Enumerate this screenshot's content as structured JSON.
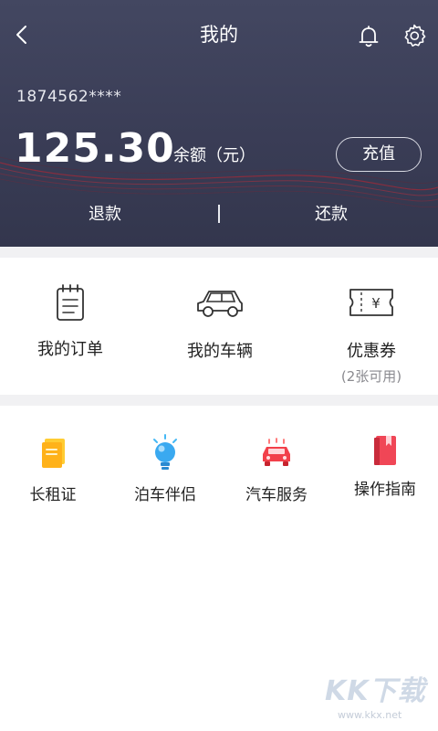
{
  "header": {
    "title": "我的",
    "phone": "1874562****",
    "balance": "125.30",
    "balance_label": "余额（元）",
    "recharge_label": "充值",
    "refund_label": "退款",
    "repay_label": "还款"
  },
  "menu": {
    "orders_label": "我的订单",
    "vehicles_label": "我的车辆",
    "coupons_label": "优惠券",
    "coupons_sub": "(2张可用)"
  },
  "services": [
    {
      "label": "长租证",
      "icon": "yellow-document-icon"
    },
    {
      "label": "泊车伴侣",
      "icon": "blue-lightbulb-icon"
    },
    {
      "label": "汽车服务",
      "icon": "red-car-icon"
    },
    {
      "label": "操作指南",
      "icon": "red-book-icon"
    }
  ],
  "watermark": {
    "logo": "KK下载",
    "url": "www.kkx.net"
  },
  "colors": {
    "header_bg": "#3a3d56",
    "accent_red": "#e63a4a",
    "divider": "#f1f1f3"
  }
}
